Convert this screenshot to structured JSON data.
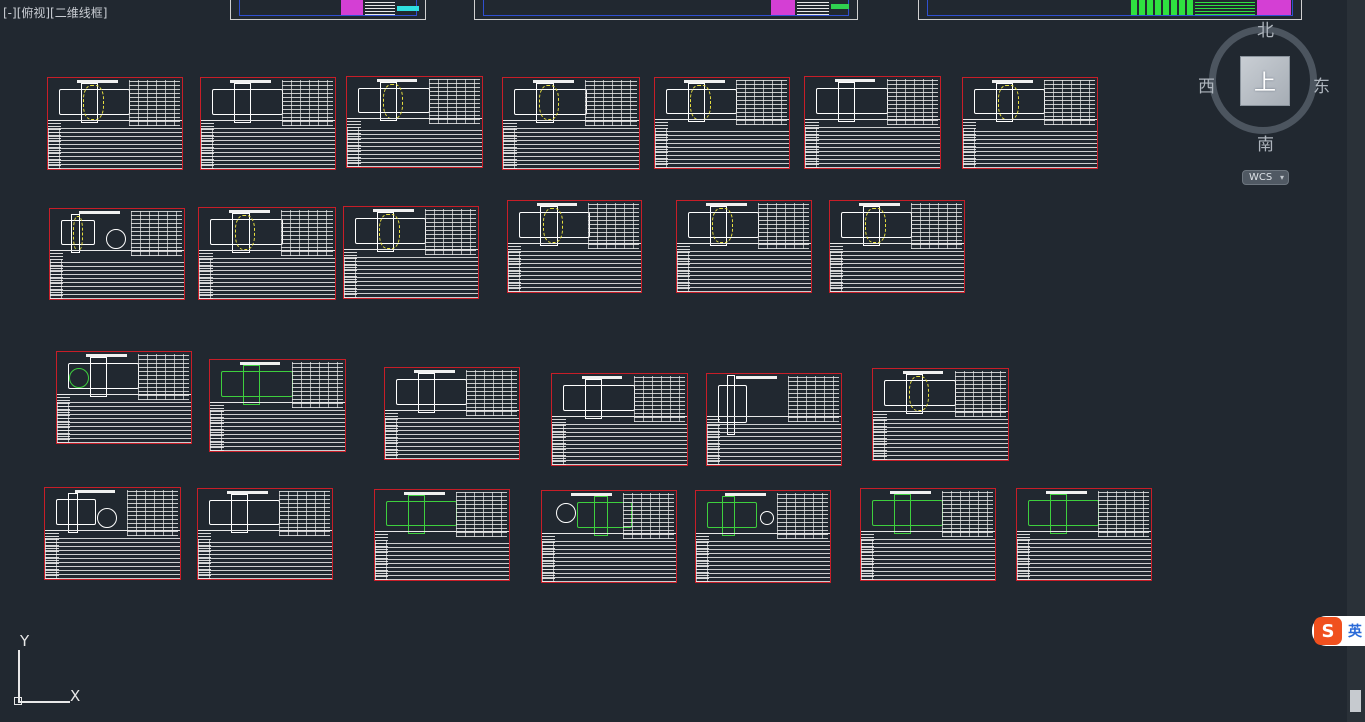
{
  "viewport": {
    "view_label": "[-][俯视][二维线框]"
  },
  "viewcube": {
    "face_label": "上",
    "north": "北",
    "south": "南",
    "east": "东",
    "west": "西"
  },
  "wcs": {
    "label": "WCS",
    "caret": "▾"
  },
  "ucs": {
    "y_label": "Y",
    "x_label": "X"
  },
  "ime": {
    "logo": "S",
    "mode": "英"
  },
  "drawing_sheet_count": 26,
  "colors": {
    "background": "#212830",
    "sheet_frame": "#c81e28",
    "part_outline": "#ffffff",
    "highlight_yellow": "#e8e040",
    "highlight_green": "#3ecf3e"
  }
}
